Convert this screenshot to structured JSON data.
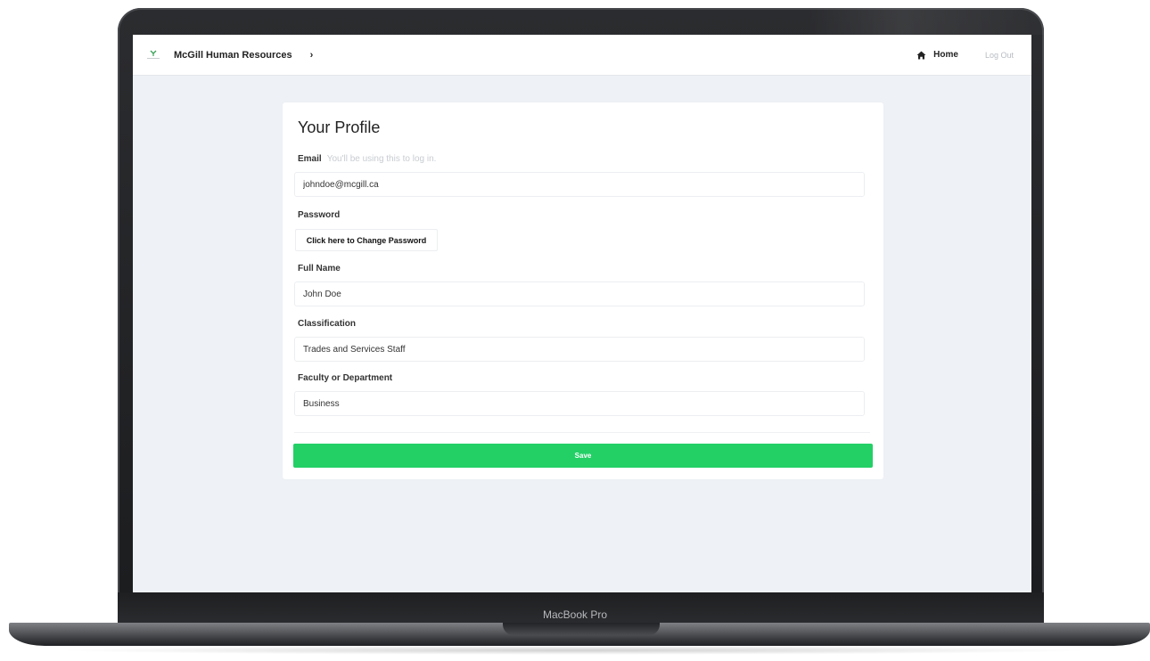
{
  "device": {
    "label": "MacBook Pro"
  },
  "navbar": {
    "brand": "McGill Human Resources",
    "breadcrumb_separator": "›",
    "home_label": "Home",
    "logout_label": "Log Out"
  },
  "profile": {
    "title": "Your Profile",
    "email": {
      "label": "Email",
      "hint": "You'll be using this to log in.",
      "value": "johndoe@mcgill.ca"
    },
    "password": {
      "label": "Password",
      "button_label": "Click here to Change Password"
    },
    "full_name": {
      "label": "Full Name",
      "value": "John Doe"
    },
    "classification": {
      "label": "Classification",
      "value": "Trades and Services Staff"
    },
    "department": {
      "label": "Faculty or Department",
      "value": "Business"
    },
    "save_label": "Save"
  },
  "colors": {
    "save_button": "#22d066",
    "screen_background": "#eef1f5"
  }
}
